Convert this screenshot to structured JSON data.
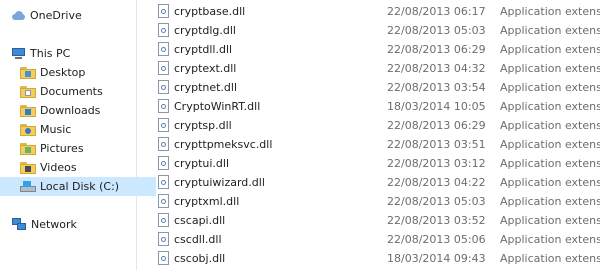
{
  "nav": {
    "items": [
      {
        "label": "OneDrive",
        "icon": "cloud-icon"
      },
      {
        "label": "This PC",
        "icon": "pc-icon"
      },
      {
        "label": "Desktop",
        "icon": "folder-desktop-icon"
      },
      {
        "label": "Documents",
        "icon": "folder-documents-icon"
      },
      {
        "label": "Downloads",
        "icon": "folder-downloads-icon"
      },
      {
        "label": "Music",
        "icon": "folder-music-icon"
      },
      {
        "label": "Pictures",
        "icon": "folder-pictures-icon"
      },
      {
        "label": "Videos",
        "icon": "folder-videos-icon"
      },
      {
        "label": "Local Disk (C:)",
        "icon": "drive-icon",
        "selected": true
      },
      {
        "label": "Network",
        "icon": "network-icon"
      }
    ]
  },
  "files": [
    {
      "name": "cryptbase.dll",
      "date": "22/08/2013 06:17",
      "type": "Application extens..."
    },
    {
      "name": "cryptdlg.dll",
      "date": "22/08/2013 05:03",
      "type": "Application extens..."
    },
    {
      "name": "cryptdll.dll",
      "date": "22/08/2013 06:29",
      "type": "Application extens..."
    },
    {
      "name": "cryptext.dll",
      "date": "22/08/2013 04:32",
      "type": "Application extens..."
    },
    {
      "name": "cryptnet.dll",
      "date": "22/08/2013 03:54",
      "type": "Application extens..."
    },
    {
      "name": "CryptoWinRT.dll",
      "date": "18/03/2014 10:05",
      "type": "Application extens..."
    },
    {
      "name": "cryptsp.dll",
      "date": "22/08/2013 06:29",
      "type": "Application extens..."
    },
    {
      "name": "crypttpmeksvc.dll",
      "date": "22/08/2013 03:51",
      "type": "Application extens..."
    },
    {
      "name": "cryptui.dll",
      "date": "22/08/2013 03:12",
      "type": "Application extens..."
    },
    {
      "name": "cryptuiwizard.dll",
      "date": "22/08/2013 04:22",
      "type": "Application extens..."
    },
    {
      "name": "cryptxml.dll",
      "date": "22/08/2013 05:03",
      "type": "Application extens..."
    },
    {
      "name": "cscapi.dll",
      "date": "22/08/2013 03:52",
      "type": "Application extens..."
    },
    {
      "name": "cscdll.dll",
      "date": "22/08/2013 05:06",
      "type": "Application extens..."
    },
    {
      "name": "cscobj.dll",
      "date": "18/03/2014 09:43",
      "type": "Application extens..."
    }
  ]
}
